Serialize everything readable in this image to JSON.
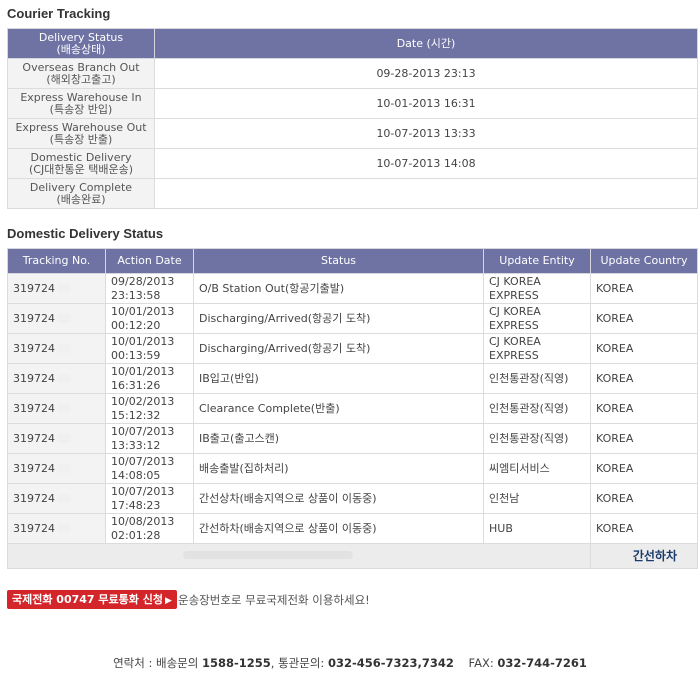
{
  "courier": {
    "title": "Courier Tracking",
    "header_status": "Delivery Status\n(배송상태)",
    "header_date": "Date (시간)",
    "rows": [
      {
        "status": "Overseas Branch Out\n(해외창고출고)",
        "date": "09-28-2013 23:13"
      },
      {
        "status": "Express Warehouse In\n(특송장 반입)",
        "date": "10-01-2013 16:31"
      },
      {
        "status": "Express Warehouse Out\n(특송장 반출)",
        "date": "10-07-2013 13:33"
      },
      {
        "status": "Domestic Delivery\n(CJ대한통운 택배운송)",
        "date": "10-07-2013 14:08"
      },
      {
        "status": "Delivery Complete\n(배송완료)",
        "date": ""
      }
    ]
  },
  "domestic": {
    "title": "Domestic Delivery Status",
    "headers": [
      "Tracking No.",
      "Action Date",
      "Status",
      "Update Entity",
      "Update Country"
    ],
    "rows": [
      {
        "tracking": "319724",
        "date": "09/28/2013\n23:13:58",
        "status": "O/B Station Out(항공기출발)",
        "entity": "CJ KOREA\nEXPRESS",
        "country": "KOREA"
      },
      {
        "tracking": "319724",
        "date": "10/01/2013\n00:12:20",
        "status": "Discharging/Arrived(항공기 도착)",
        "entity": "CJ KOREA\nEXPRESS",
        "country": "KOREA"
      },
      {
        "tracking": "319724",
        "date": "10/01/2013\n00:13:59",
        "status": "Discharging/Arrived(항공기 도착)",
        "entity": "CJ KOREA\nEXPRESS",
        "country": "KOREA"
      },
      {
        "tracking": "319724",
        "date": "10/01/2013\n16:31:26",
        "status": "IB입고(반입)",
        "entity": "인천통관장(직영)",
        "country": "KOREA"
      },
      {
        "tracking": "319724",
        "date": "10/02/2013\n15:12:32",
        "status": "Clearance Complete(반출)",
        "entity": "인천통관장(직영)",
        "country": "KOREA"
      },
      {
        "tracking": "319724",
        "date": "10/07/2013\n13:33:12",
        "status": "IB출고(출고스캔)",
        "entity": "인천통관장(직영)",
        "country": "KOREA"
      },
      {
        "tracking": "319724",
        "date": "10/07/2013\n14:08:05",
        "status": "배송출발(집하처리)",
        "entity": "씨엠티서비스",
        "country": "KOREA"
      },
      {
        "tracking": "319724",
        "date": "10/07/2013\n17:48:23",
        "status": "간선상차(배송지역으로 상품이 이동중)",
        "entity": "인천남",
        "country": "KOREA"
      },
      {
        "tracking": "319724",
        "date": "10/08/2013\n02:01:28",
        "status": "간선하차(배송지역으로 상품이 이동중)",
        "entity": "HUB",
        "country": "KOREA"
      }
    ],
    "footer_status": "간선하차"
  },
  "call_button": "국제전화 00747 무료통화 신청",
  "call_note": "운송장번호로 무료국제전화 이용하세요!",
  "contact": {
    "prefix": "연락처 : 배송문의 ",
    "delivery_phone": "1588-1255",
    "customs_label": ", 통관문의: ",
    "customs_phone": "032-456-7323,7342",
    "fax_label": "FAX: ",
    "fax": "032-744-7261"
  },
  "colors": {
    "header_bg": "#6f73a4",
    "call_button_bg": "#d3252a",
    "footer_text": "#1a3a6b"
  }
}
